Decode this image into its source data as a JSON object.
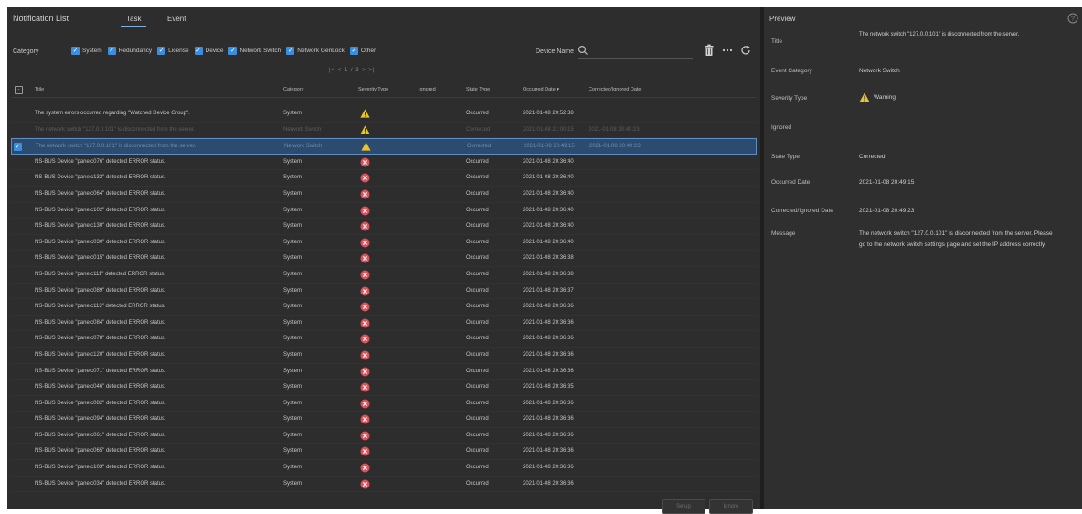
{
  "header": {
    "title": "Notification List",
    "tabs": [
      {
        "label": "Task",
        "active": true
      },
      {
        "label": "Event",
        "active": false
      }
    ]
  },
  "filters": {
    "category_label": "Category",
    "categories": [
      "System",
      "Redundancy",
      "License",
      "Device",
      "Network Switch",
      "Network GenLock",
      "Other"
    ],
    "device_name_label": "Device Name",
    "device_name_value": ""
  },
  "pager": "|< < 1 / 3 > >|",
  "table": {
    "headers": {
      "title": "Title",
      "category": "Category",
      "severity": "Severity Type",
      "ignored": "Ignored",
      "state": "State Type",
      "occurred": "Occurred Date  ▾",
      "corrected": "Corrected/Ignored Date"
    },
    "rows": [
      {
        "title": "The system errors occurred regarding \"Watched Device Group\".",
        "category": "System",
        "severity": "warning",
        "state": "Occurred",
        "occurred": "2021-01-08 20:52:38",
        "corrected": "",
        "style": "normal"
      },
      {
        "title": "The network switch \"127.0.0.101\" is disconnected from the server.",
        "category": "Network Switch",
        "severity": "warning",
        "state": "Corrected",
        "occurred": "2021-01-08 21:00:15",
        "corrected": "2021-01-08 20:49:23",
        "style": "dim"
      },
      {
        "title": "The network switch \"127.0.0.101\" is disconnected from the server.",
        "category": "Network Switch",
        "severity": "warning",
        "state": "Corrected",
        "occurred": "2021-01-08 20:49:15",
        "corrected": "2021-01-08 20:49:23",
        "style": "selected"
      },
      {
        "title": "NS-BUS Device \"panelc076\" detected ERROR status.",
        "category": "System",
        "severity": "error",
        "state": "Occurred",
        "occurred": "2021-01-08 20:36:40",
        "corrected": "",
        "style": "normal"
      },
      {
        "title": "NS-BUS Device \"panelc132\" detected ERROR status.",
        "category": "System",
        "severity": "error",
        "state": "Occurred",
        "occurred": "2021-01-08 20:36:40",
        "corrected": "",
        "style": "normal"
      },
      {
        "title": "NS-BUS Device \"panelc064\" detected ERROR status.",
        "category": "System",
        "severity": "error",
        "state": "Occurred",
        "occurred": "2021-01-08 20:36:40",
        "corrected": "",
        "style": "normal"
      },
      {
        "title": "NS-BUS Device \"panelc102\" detected ERROR status.",
        "category": "System",
        "severity": "error",
        "state": "Occurred",
        "occurred": "2021-01-08 20:36:40",
        "corrected": "",
        "style": "normal"
      },
      {
        "title": "NS-BUS Device \"panelc130\" detected ERROR status.",
        "category": "System",
        "severity": "error",
        "state": "Occurred",
        "occurred": "2021-01-08 20:36:40",
        "corrected": "",
        "style": "normal"
      },
      {
        "title": "NS-BUS Device \"panelc030\" detected ERROR status.",
        "category": "System",
        "severity": "error",
        "state": "Occurred",
        "occurred": "2021-01-08 20:36:40",
        "corrected": "",
        "style": "normal"
      },
      {
        "title": "NS-BUS Device \"panelc015\" detected ERROR status.",
        "category": "System",
        "severity": "error",
        "state": "Occurred",
        "occurred": "2021-01-08 20:36:38",
        "corrected": "",
        "style": "normal"
      },
      {
        "title": "NS-BUS Device \"panelc111\" detected ERROR status.",
        "category": "System",
        "severity": "error",
        "state": "Occurred",
        "occurred": "2021-01-08 20:36:38",
        "corrected": "",
        "style": "normal"
      },
      {
        "title": "NS-BUS Device \"panelc089\" detected ERROR status.",
        "category": "System",
        "severity": "error",
        "state": "Occurred",
        "occurred": "2021-01-08 20:36:37",
        "corrected": "",
        "style": "normal"
      },
      {
        "title": "NS-BUS Device \"panelc113\" detected ERROR status.",
        "category": "System",
        "severity": "error",
        "state": "Occurred",
        "occurred": "2021-01-08 20:36:36",
        "corrected": "",
        "style": "normal"
      },
      {
        "title": "NS-BUS Device \"panelc084\" detected ERROR status.",
        "category": "System",
        "severity": "error",
        "state": "Occurred",
        "occurred": "2021-01-08 20:36:36",
        "corrected": "",
        "style": "normal"
      },
      {
        "title": "NS-BUS Device \"panelc078\" detected ERROR status.",
        "category": "System",
        "severity": "error",
        "state": "Occurred",
        "occurred": "2021-01-08 20:36:36",
        "corrected": "",
        "style": "normal"
      },
      {
        "title": "NS-BUS Device \"panelc120\" detected ERROR status.",
        "category": "System",
        "severity": "error",
        "state": "Occurred",
        "occurred": "2021-01-08 20:36:36",
        "corrected": "",
        "style": "normal"
      },
      {
        "title": "NS-BUS Device \"panelc071\" detected ERROR status.",
        "category": "System",
        "severity": "error",
        "state": "Occurred",
        "occurred": "2021-01-08 20:36:36",
        "corrected": "",
        "style": "normal"
      },
      {
        "title": "NS-BUS Device \"panelc046\" detected ERROR status.",
        "category": "System",
        "severity": "error",
        "state": "Occurred",
        "occurred": "2021-01-08 20:36:35",
        "corrected": "",
        "style": "normal"
      },
      {
        "title": "NS-BUS Device \"panelc082\" detected ERROR status.",
        "category": "System",
        "severity": "error",
        "state": "Occurred",
        "occurred": "2021-01-08 20:36:36",
        "corrected": "",
        "style": "normal"
      },
      {
        "title": "NS-BUS Device \"panelc094\" detected ERROR status.",
        "category": "System",
        "severity": "error",
        "state": "Occurred",
        "occurred": "2021-01-08 20:36:36",
        "corrected": "",
        "style": "normal"
      },
      {
        "title": "NS-BUS Device \"panelc061\" detected ERROR status.",
        "category": "System",
        "severity": "error",
        "state": "Occurred",
        "occurred": "2021-01-08 20:36:36",
        "corrected": "",
        "style": "normal"
      },
      {
        "title": "NS-BUS Device \"panelc065\" detected ERROR status.",
        "category": "System",
        "severity": "error",
        "state": "Occurred",
        "occurred": "2021-01-08 20:36:36",
        "corrected": "",
        "style": "normal"
      },
      {
        "title": "NS-BUS Device \"panelc103\" detected ERROR status.",
        "category": "System",
        "severity": "error",
        "state": "Occurred",
        "occurred": "2021-01-08 20:36:36",
        "corrected": "",
        "style": "normal"
      },
      {
        "title": "NS-BUS Device \"panelc034\" detected ERROR status.",
        "category": "System",
        "severity": "error",
        "state": "Occurred",
        "occurred": "2021-01-08 20:36:36",
        "corrected": "",
        "style": "normal"
      }
    ]
  },
  "footer": {
    "setup_label": "Setup",
    "ignore_label": "Ignore"
  },
  "preview": {
    "title": "Preview",
    "fields": {
      "title_key": "Title",
      "title_val": "The network switch \"127.0.0.101\" is disconnected from the server.",
      "event_category_key": "Event Category",
      "event_category_val": "Network Switch",
      "severity_key": "Severity Type",
      "severity_val": "Warning",
      "ignored_key": "Ignored",
      "ignored_val": "",
      "state_key": "State Type",
      "state_val": "Corrected",
      "occurred_key": "Occurred Date",
      "occurred_val": "2021-01-08 20:49:15",
      "corrected_key": "Corrected/Ignored Date",
      "corrected_val": "2021-01-08 20:49:23",
      "message_key": "Message",
      "message_val": "The network switch \"127.0.0.101\" is disconnected from the server. Please go to the network switch settings page and set the IP address correctly."
    }
  },
  "colors": {
    "accent": "#3a8ee0",
    "warning": "#e8c42a",
    "error": "#e0505a",
    "selected_row": "#2c4b6e",
    "background": "#2b2b2b"
  },
  "icons": {
    "search": "search-icon",
    "delete": "trash-icon",
    "more": "more-icon",
    "refresh": "refresh-icon",
    "help": "help-icon",
    "warning": "warning-icon",
    "error": "error-icon"
  }
}
